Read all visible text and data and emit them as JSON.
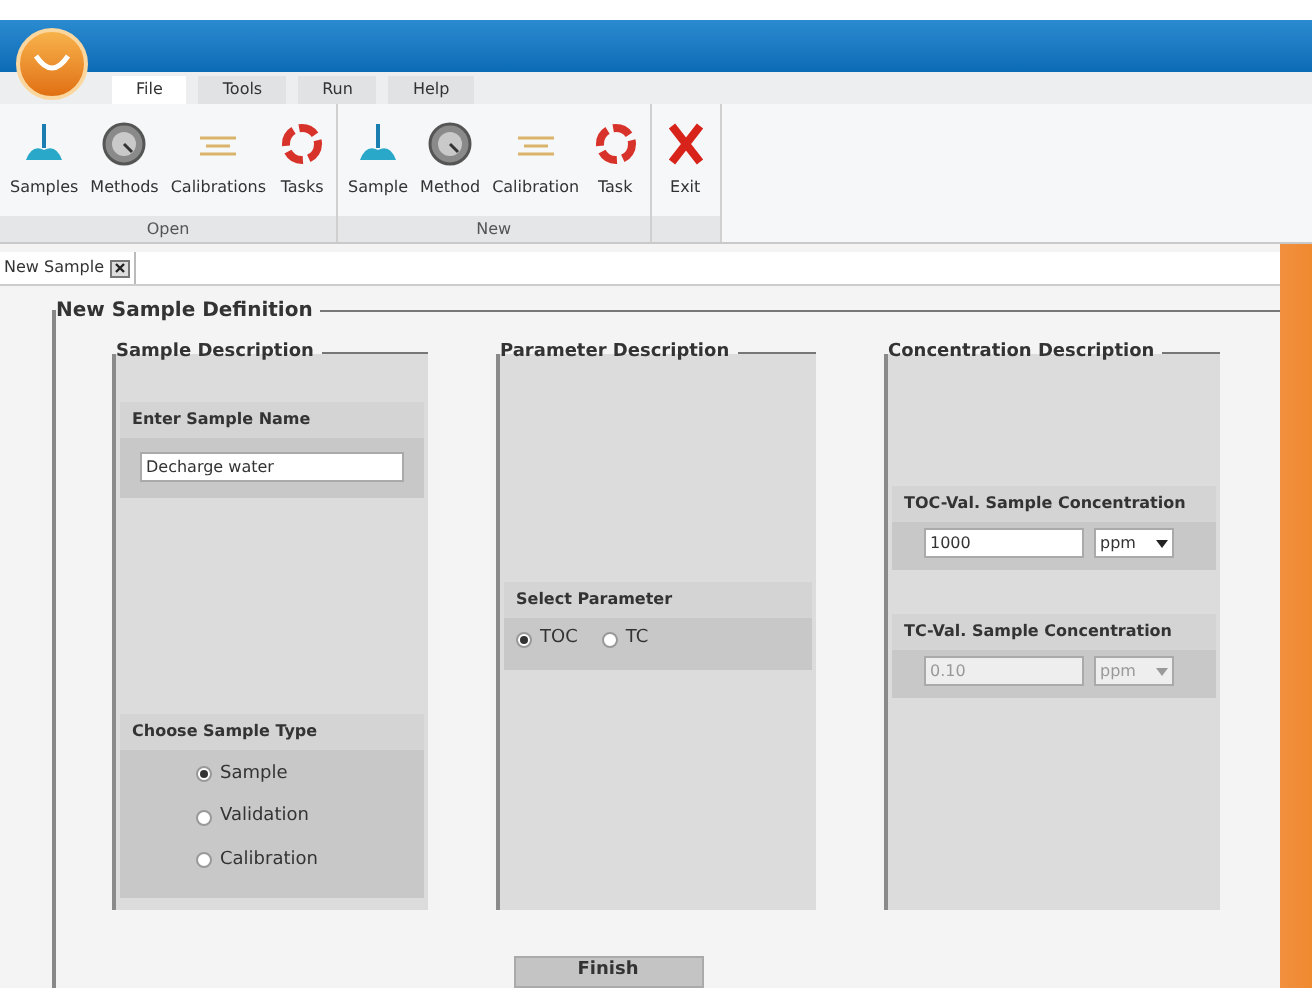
{
  "menu_tabs": [
    {
      "label": "File",
      "selected": true
    },
    {
      "label": "Tools",
      "selected": false
    },
    {
      "label": "Run",
      "selected": false
    },
    {
      "label": "Help",
      "selected": false
    }
  ],
  "ribbon_groups": [
    {
      "label": "Open",
      "buttons": [
        {
          "label": "Samples",
          "kind": "sample"
        },
        {
          "label": "Methods",
          "kind": "method"
        },
        {
          "label": "Calibrations",
          "kind": "calibration"
        },
        {
          "label": "Tasks",
          "kind": "task"
        }
      ]
    },
    {
      "label": "New",
      "buttons": [
        {
          "label": "Sample",
          "kind": "sample"
        },
        {
          "label": "Method",
          "kind": "method"
        },
        {
          "label": "Calibration",
          "kind": "calibration"
        },
        {
          "label": "Task",
          "kind": "task"
        }
      ]
    },
    {
      "buttons": [
        {
          "label": "Exit",
          "kind": "exit"
        }
      ]
    }
  ],
  "document_tab": {
    "label": "New Sample"
  },
  "form": {
    "title": "New Sample Definition",
    "sample_description": {
      "title": "Sample Description",
      "name_label": "Enter Sample Name",
      "name_value": "Decharge water",
      "type_label": "Choose Sample Type",
      "types": [
        {
          "label": "Sample",
          "selected": true
        },
        {
          "label": "Validation",
          "selected": false
        },
        {
          "label": "Calibration",
          "selected": false
        }
      ]
    },
    "parameter_description": {
      "title": "Parameter Description",
      "select_label": "Select Parameter",
      "options": [
        {
          "label": "TOC",
          "selected": true
        },
        {
          "label": "TC",
          "selected": false
        }
      ]
    },
    "concentration_description": {
      "title": "Concentration Description",
      "fields": [
        {
          "label": "TOC-Val. Sample Concentration",
          "value": "1000",
          "unit": "ppm",
          "disabled": false
        },
        {
          "label": "TC-Val. Sample Concentration",
          "value": "0.10",
          "unit": "ppm",
          "disabled": true
        }
      ]
    },
    "finish_button": "Finish"
  }
}
